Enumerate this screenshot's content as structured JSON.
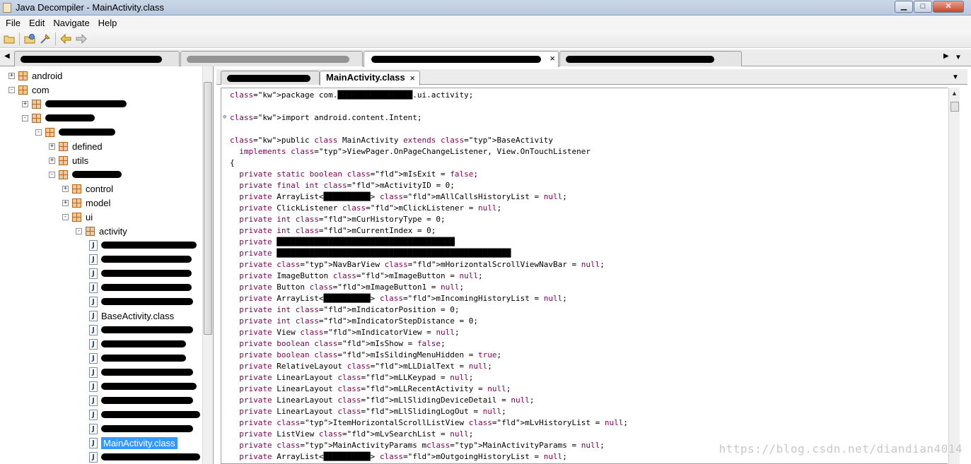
{
  "window": {
    "title": "Java Decompiler - MainActivity.class",
    "minimize": "▁",
    "maximize": "□",
    "close": "✕"
  },
  "menu": [
    "File",
    "Edit",
    "Navigate",
    "Help"
  ],
  "toolbar": {
    "icons": [
      "open-folder-icon",
      "open-type-icon",
      "settings-icon",
      "back-icon",
      "forward-icon"
    ]
  },
  "file_tabs": [
    {
      "label": "",
      "active": false
    },
    {
      "label": "",
      "active": false
    },
    {
      "label": "",
      "active": true,
      "close": "×"
    },
    {
      "label": "",
      "active": false
    }
  ],
  "tree": {
    "nodes": [
      {
        "label": "android",
        "kind": "package",
        "expander": "+"
      },
      {
        "label": "com",
        "kind": "package",
        "expander": "-"
      },
      {
        "label": "",
        "kind": "package",
        "expander": "+"
      },
      {
        "label": "",
        "kind": "package",
        "expander": "-"
      },
      {
        "label": "",
        "kind": "package",
        "expander": "-"
      },
      {
        "label": "defined",
        "kind": "package",
        "expander": "+"
      },
      {
        "label": "utils",
        "kind": "package",
        "expander": "+"
      },
      {
        "label": "",
        "kind": "package",
        "expander": "-"
      },
      {
        "label": "control",
        "kind": "package",
        "expander": "+"
      },
      {
        "label": "model",
        "kind": "package",
        "expander": "+"
      },
      {
        "label": "ui",
        "kind": "package",
        "expander": "-"
      },
      {
        "label": "activity",
        "kind": "package",
        "expander": "-"
      },
      {
        "label": "",
        "kind": "class"
      },
      {
        "label": "",
        "kind": "class"
      },
      {
        "label": "",
        "kind": "class"
      },
      {
        "label": "",
        "kind": "class"
      },
      {
        "label": "",
        "kind": "class"
      },
      {
        "label": "BaseActivity.class",
        "kind": "class"
      },
      {
        "label": "",
        "kind": "class"
      },
      {
        "label": "",
        "kind": "class"
      },
      {
        "label": "",
        "kind": "class"
      },
      {
        "label": "",
        "kind": "class"
      },
      {
        "label": "",
        "kind": "class"
      },
      {
        "label": "",
        "kind": "class"
      },
      {
        "label": "",
        "kind": "class"
      },
      {
        "label": "",
        "kind": "class"
      },
      {
        "label": "MainActivity.class",
        "kind": "class",
        "selected": true
      },
      {
        "label": "",
        "kind": "class"
      }
    ]
  },
  "editor_tabs": [
    {
      "label": "",
      "active": false
    },
    {
      "label": "MainActivity.class",
      "active": true,
      "close": "×"
    }
  ],
  "code": {
    "lines": [
      "package com.████████████████.ui.activity;",
      "",
      "import android.content.Intent;",
      "",
      "public class MainActivity extends BaseActivity",
      "  implements ViewPager.OnPageChangeListener, View.OnTouchListener",
      "{",
      "  private static boolean mIsExit = false;",
      "  private final int mActivityID = 0;",
      "  private ArrayList<██████████> mAllCallsHistoryList = null;",
      "  private ClickListener mClickListener = null;",
      "  private int mCurHistoryType = 0;",
      "  private int mCurrentIndex = 0;",
      "  private ██████████████████████████████████████",
      "  private ██████████████████████████████████████████████████",
      "  private NavBarView mHorizontalScrollViewNavBar = null;",
      "  private ImageButton mImageButton = null;",
      "  private Button mImageButton1 = null;",
      "  private ArrayList<██████████> mIncomingHistoryList = null;",
      "  private int mIndicatorPosition = 0;",
      "  private int mIndicatorStepDistance = 0;",
      "  private View mIndicatorView = null;",
      "  private boolean mIsShow = false;",
      "  private boolean mIsSildingMenuHidden = true;",
      "  private RelativeLayout mLLDialText = null;",
      "  private LinearLayout mLLKeypad = null;",
      "  private LinearLayout mLLRecentActivity = null;",
      "  private LinearLayout mLlSlidingDeviceDetail = null;",
      "  private LinearLayout mLlSlidingLogOut = null;",
      "  private ItemHorizontalScrollListView mLvHistoryList = null;",
      "  private ListView mLvSearchList = null;",
      "  private MainActivityParams mMainActivityParams = null;",
      "  private ArrayList<██████████> mOutgoingHistoryList = null;"
    ]
  },
  "watermark": "https://blog.csdn.net/diandian4014"
}
